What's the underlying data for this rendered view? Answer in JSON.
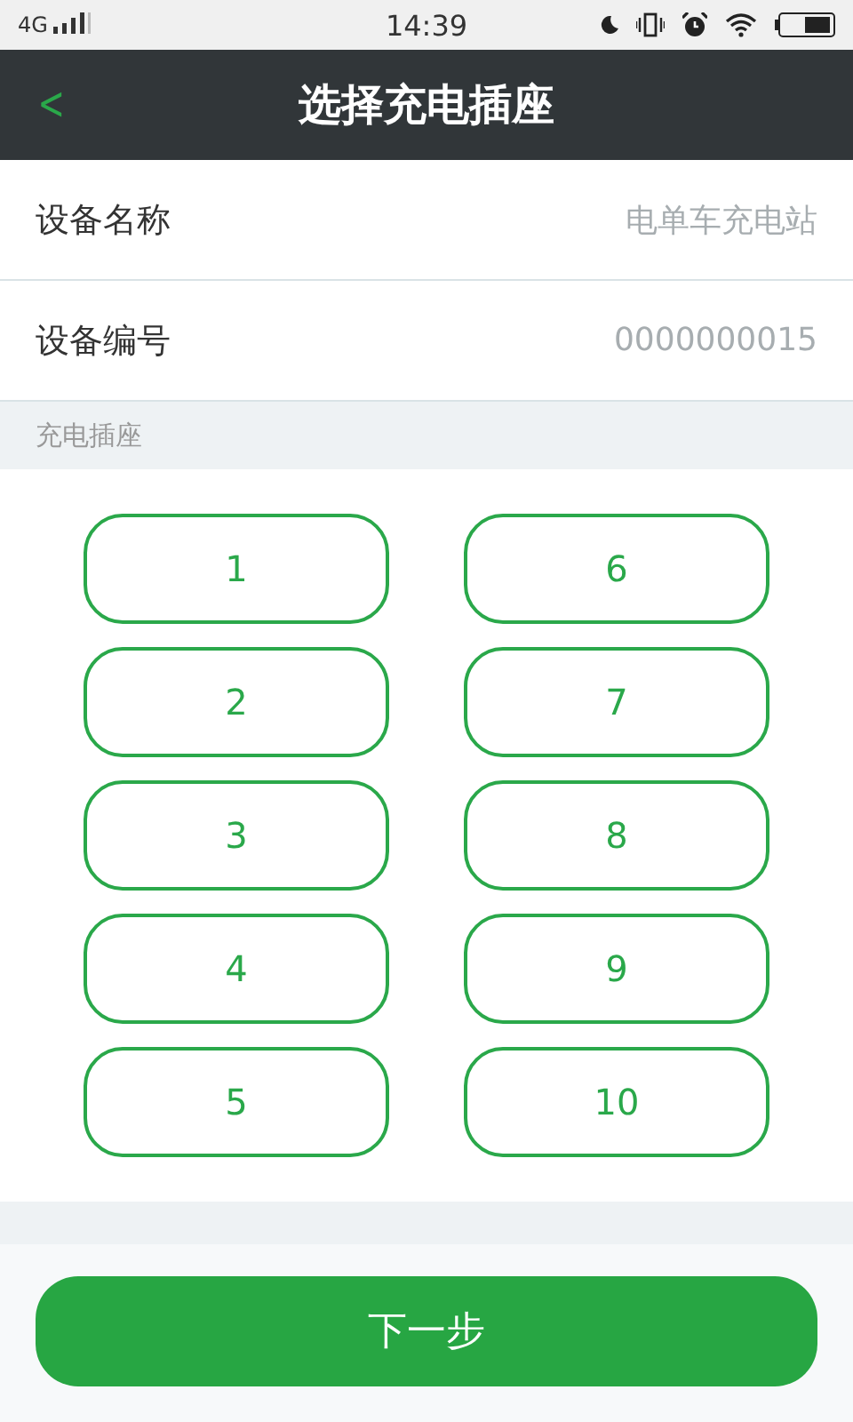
{
  "status_bar": {
    "network": "4G",
    "time": "14:39"
  },
  "header": {
    "back_icon": "<",
    "title": "选择充电插座"
  },
  "info_rows": [
    {
      "label": "设备名称",
      "value": "电单车充电站"
    },
    {
      "label": "设备编号",
      "value": "0000000015"
    }
  ],
  "section_label": "充电插座",
  "sockets": [
    {
      "label": "1",
      "selected": false
    },
    {
      "label": "2",
      "selected": false
    },
    {
      "label": "3",
      "selected": false
    },
    {
      "label": "4",
      "selected": false
    },
    {
      "label": "5",
      "selected": false
    },
    {
      "label": "6",
      "selected": false
    },
    {
      "label": "7",
      "selected": false
    },
    {
      "label": "8",
      "selected": false
    },
    {
      "label": "9",
      "selected": false
    },
    {
      "label": "10",
      "selected": false
    }
  ],
  "next_button": "下一步"
}
